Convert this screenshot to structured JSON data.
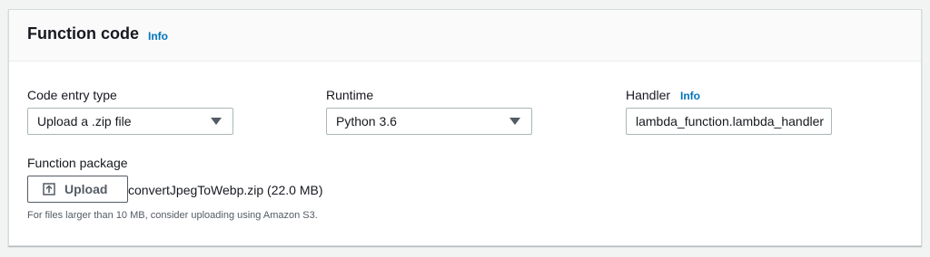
{
  "panel": {
    "title": "Function code",
    "info_label": "Info"
  },
  "code_entry_type": {
    "label": "Code entry type",
    "value": "Upload a .zip file"
  },
  "runtime": {
    "label": "Runtime",
    "value": "Python 3.6"
  },
  "handler": {
    "label": "Handler",
    "info_label": "Info",
    "value": "lambda_function.lambda_handler"
  },
  "function_package": {
    "label": "Function package",
    "upload_label": "Upload",
    "file_name": "convertJpegToWebp.zip (22.0 MB)",
    "hint": "For files larger than 10 MB, consider uploading using Amazon S3."
  },
  "icons": {
    "caret": "chevron-down-icon",
    "upload": "upload-icon"
  },
  "colors": {
    "link": "#0073bb",
    "border": "#aab7b8",
    "button_border": "#545b64"
  }
}
